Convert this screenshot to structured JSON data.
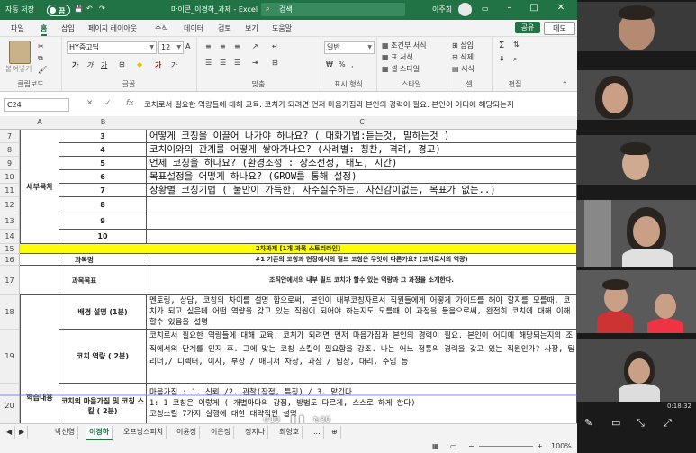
{
  "titlebar": {
    "autosave": "자동 저장",
    "toggle": "끔",
    "filename": "마이콘_이경하_과제 - Excel",
    "search_placeholder": "검색",
    "user": "이주희",
    "minimize": "–",
    "restore": "□",
    "close": "✕"
  },
  "ribbon_tabs": [
    "파일",
    "홈",
    "삽입",
    "페이지 레이아웃",
    "수식",
    "데이터",
    "검토",
    "보기",
    "도움말"
  ],
  "ribbon_actions": {
    "share": "공유",
    "memo": "메모"
  },
  "ribbon": {
    "paste": "붙여넣기",
    "clipboard": "클립보드",
    "font_name": "HY중고딕",
    "font_size": "12",
    "font_group": "글꼴",
    "align_group": "맞춤",
    "number_format": "일반",
    "number_group": "표시 형식",
    "cond_format": "조건부 서식",
    "table_format": "표 서식",
    "cell_style": "셀 스타일",
    "style_group": "스타일",
    "insert": "삽입",
    "delete": "삭제",
    "format": "서식",
    "cell_group": "셀",
    "edit_group": "편집"
  },
  "formula_bar": {
    "name_box": "C24",
    "fx": "fx",
    "formula": "코치로서 필요한 역량들에 대해 교육. 코치가 되려면 먼저 마음가짐과 본인의 경력이 필요. 본인이 어디에 해당되는지"
  },
  "columns": [
    "A",
    "B",
    "C"
  ],
  "rows": {
    "r7": {
      "num": "7",
      "b": "3",
      "c": "어떻게 코칭을 이끌어 나가야 하나요? ( 대화기법:듣는것, 말하는것 )"
    },
    "r8": {
      "num": "8",
      "b": "4",
      "c": "코치이와의 관계를 어떻게 쌓아가나요? (사례별: 칭찬, 격려, 경고)"
    },
    "r9": {
      "num": "9",
      "b": "5",
      "c": "언제 코칭을 하나요? (환경조성 : 장소선정, 태도, 시간)"
    },
    "r10": {
      "num": "10",
      "b": "6",
      "c": "목표설정을 어떻게 하나요? (GROW를 통해 설정)"
    },
    "r11": {
      "num": "11",
      "b": "7",
      "c": "상황별 코칭기법 ( 불만이 가득한, 자주실수하는, 자신감이없는, 목표가 없는..)"
    },
    "r12": {
      "num": "12",
      "b": "8",
      "c": ""
    },
    "r13": {
      "num": "13",
      "b": "9",
      "c": ""
    },
    "r14": {
      "num": "14",
      "b": "10",
      "c": ""
    },
    "r15": {
      "num": "15",
      "c": "2차과제 [1개 과목 스토리라인]"
    },
    "r16": {
      "num": "16",
      "b": "과목명",
      "c": "#1 기존의 코칭과 현장에서의 필드 코칭은 무엇이 다른가요? (코치로서의 역량)"
    },
    "r17": {
      "num": "17",
      "b": "과목목표",
      "c": "조직안에서의 내부 필드 코치가 할수 있는 역량과 그 과정을 소개한다."
    },
    "r18": {
      "num": "18",
      "b": "배경 설명 (1분)",
      "c": "멘토링, 상담, 코칭의 차이를 설명 함으로써, 본인이 내부코칭자로서 직원들에게 어떻게 가이드를 해야 할지를 모를때, 코치가 되고 싶은데 어떤 역량을 갖고 있는 직원이 되어야 하는지도 모를때 이 과정을 들음으로써, 완전히 코치에 대해 이해 할수 있음을 설명"
    },
    "r19": {
      "num": "19",
      "b": "코치 역량 ( 2분)",
      "c": "코치로서 필요한 역량들에 대해 교육. 코치가 되려면 먼저 마음가짐과 본인의 경력이 필요. 본인이 어디에 해당되는지의 조직에서의 단계를 인지 후. 그에 맞는 코칭 스킬이 필요함을 강조. 나는 어느 정통의 경력을 갖고 있는 직원인가? 사장, 팀리더,/ 디렉터, 이사, 부장 / 매니저 차장, 과장 / 팀장, 대리, 주임 등"
    },
    "r20": {
      "num": "20",
      "b": "코치의 마음가짐 및 코칭 스킬 ( 2분)",
      "c1": "마음가짐 : 1. 신뢰 /2. 관찰(장점, 특징) / 3. 맡긴다",
      "c2": "1: 1 코칭은 이렇게 ( 개별마다의 강점, 방법도 다르게, 스스로 하게 한다)",
      "c3": "코칭스킬 7가지 실행에 대한 대략적인 설명"
    }
  },
  "merged_labels": {
    "detail": "세부목차",
    "content": "학습내용"
  },
  "sheet_tabs": [
    "박선영",
    "이경하",
    "오프닝스피치",
    "이윤정",
    "이은정",
    "정지나",
    "최형호",
    "..."
  ],
  "active_sheet": "이경하",
  "status": {
    "zoom": "100%"
  },
  "video": {
    "time": "0:18:32",
    "back": "10",
    "fwd": "30"
  }
}
